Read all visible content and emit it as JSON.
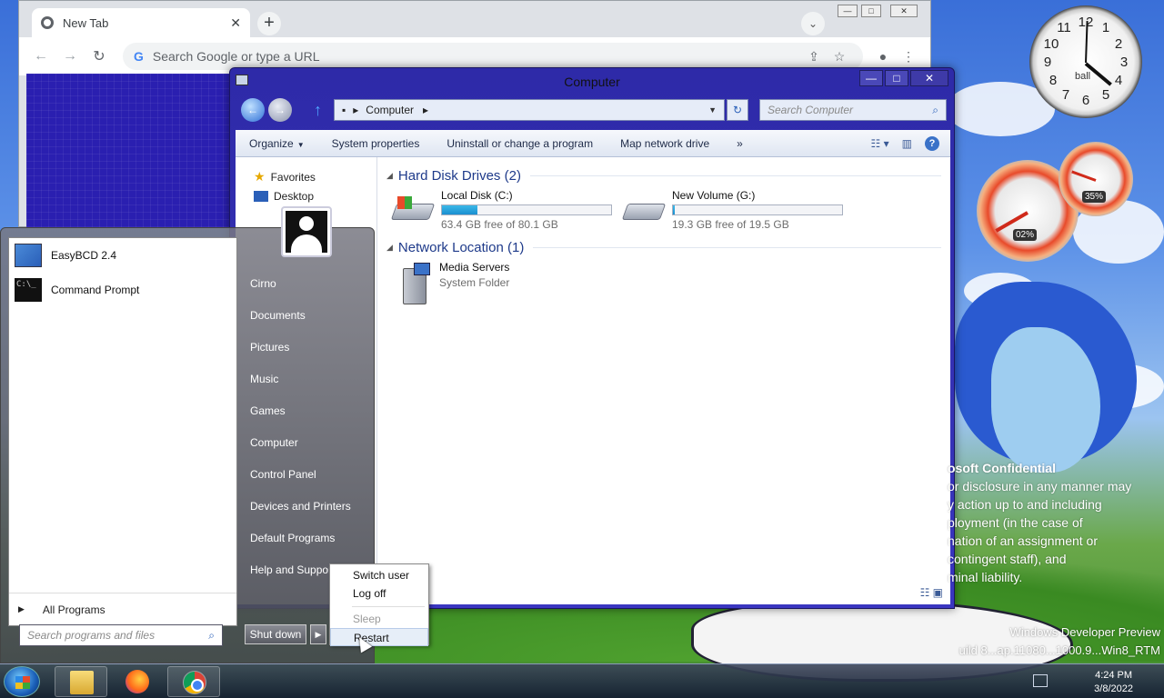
{
  "chrome": {
    "tab_title": "New Tab",
    "omnibox_placeholder": "Search Google or type a URL"
  },
  "explorer": {
    "title": "Computer",
    "address": "Computer",
    "search_placeholder": "Search Computer",
    "commands": [
      "Organize",
      "System properties",
      "Uninstall or change a program",
      "Map network drive"
    ],
    "nav": [
      {
        "label": "Favorites",
        "icon": "star-icon"
      },
      {
        "label": "Desktop",
        "icon": "desktop-icon"
      }
    ],
    "hard_disk_group": "Hard Disk Drives (2)",
    "drives": [
      {
        "name": "Local Disk (C:)",
        "free_text": "63.4 GB free of 80.1 GB",
        "used_fraction": 0.21
      },
      {
        "name": "New Volume (G:)",
        "free_text": "19.3 GB free of 19.5 GB",
        "used_fraction": 0.01
      }
    ],
    "network_group": "Network Location (1)",
    "network_item": {
      "name": "Media Servers",
      "type": "System Folder"
    }
  },
  "startmenu": {
    "pinned": [
      {
        "label": "EasyBCD 2.4",
        "icon": "easybcd-icon"
      },
      {
        "label": "Command Prompt",
        "icon": "command-prompt-icon"
      }
    ],
    "all_programs": "All Programs",
    "search_placeholder": "Search programs and files",
    "right_items": [
      "Cirno",
      "Documents",
      "Pictures",
      "Music",
      "Games",
      "Computer",
      "Control Panel",
      "Devices and Printers",
      "Default Programs",
      "Help and Support"
    ],
    "shutdown_label": "Shut down"
  },
  "shutdown_submenu": {
    "items": [
      "Switch user",
      "Log off"
    ],
    "sleep": "Sleep",
    "restart": "Restart"
  },
  "taskbar": {
    "time": "4:24 PM",
    "date": "3/8/2022"
  },
  "gadgets": {
    "clock_label": "ball",
    "cpu_percent": "02%",
    "memory_percent": "35%"
  },
  "watermark": {
    "heading": "osoft Confidential",
    "lines": [
      "or disclosure in any manner may",
      "y action up to and including",
      "ployment (in the case of",
      "nation of an assignment or",
      "contingent staff), and",
      "minal liability."
    ],
    "build_line1": "Windows Developer Preview",
    "build_line2": "uild 8...ap.11080...1000.9...Win8_RTM"
  }
}
